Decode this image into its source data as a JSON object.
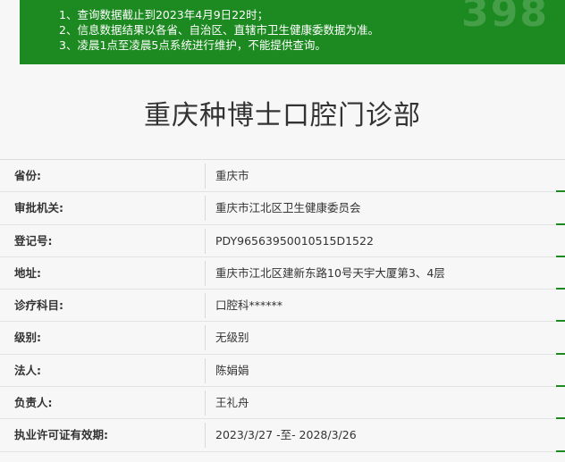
{
  "notice": {
    "lines": [
      "1、查询数据截止到2023年4月9日22时；",
      "2、信息数据结果以各省、自治区、直辖市卫生健康委数据为准。",
      "3、凌晨1点至凌晨5点系统进行维护，不能提供查询。"
    ],
    "watermark": "398"
  },
  "clinic": {
    "title": "重庆种博士口腔门诊部"
  },
  "details": [
    {
      "label": "省份:",
      "value": "重庆市"
    },
    {
      "label": "审批机关:",
      "value": "重庆市江北区卫生健康委员会"
    },
    {
      "label": "登记号:",
      "value": "PDY96563950010515D1522"
    },
    {
      "label": "地址:",
      "value": "重庆市江北区建新东路10号天宇大厦第3、4层"
    },
    {
      "label": "诊疗科目:",
      "value": "口腔科******"
    },
    {
      "label": "级别:",
      "value": "无级别"
    },
    {
      "label": "法人:",
      "value": "陈娟娟"
    },
    {
      "label": "负责人:",
      "value": "王礼舟"
    },
    {
      "label": "执业许可证有效期:",
      "value": "2023/3/27 -至- 2028/3/26"
    }
  ],
  "colors": {
    "notice_bg": "#1d8a21",
    "accent": "#1d8a21",
    "text": "#333333"
  }
}
